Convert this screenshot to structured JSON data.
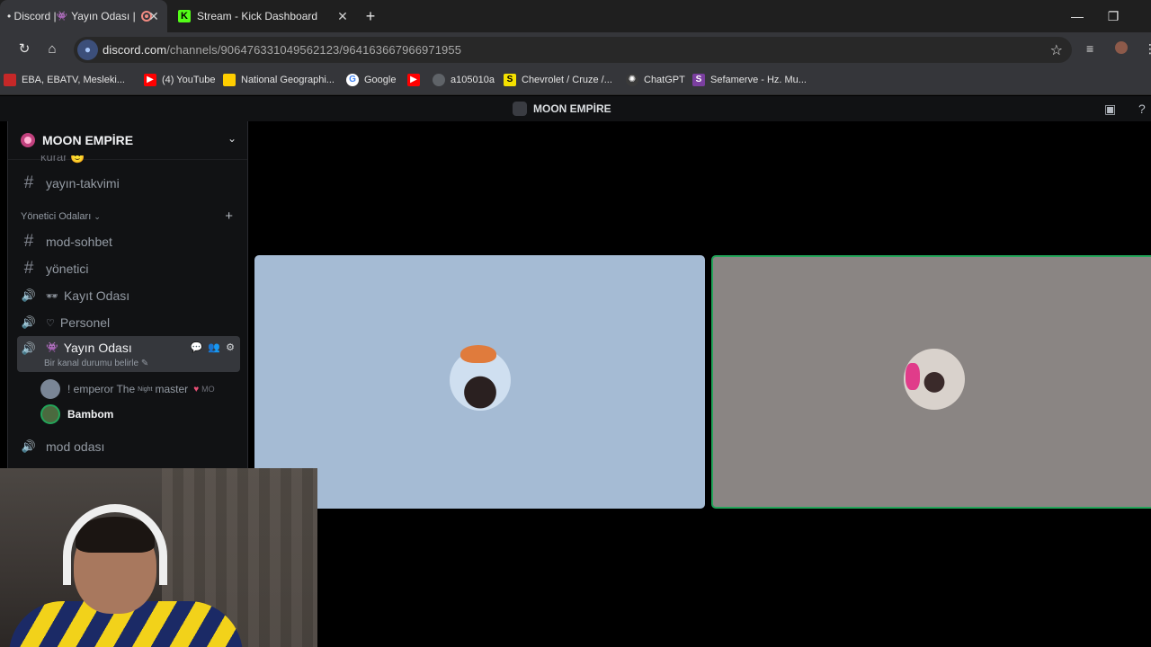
{
  "browser": {
    "tabs": [
      {
        "title": "• Discord | ",
        "sub_emoji": "👾",
        "sub_title": "Yayın Odası |",
        "active": true
      },
      {
        "title": "Stream - Kick Dashboard",
        "active": false
      }
    ],
    "url_main": "discord.com",
    "url_path": "/channels/906476331049562123/964163667966971955",
    "bookmarks": [
      {
        "label": "EBA, EBATV, Mesleki...",
        "color": "#e53935"
      },
      {
        "label": "(4) YouTube",
        "color": "#ff0000"
      },
      {
        "label": "National Geographi...",
        "color": "#ffce00"
      },
      {
        "label": "Google",
        "color": "#ffffff"
      },
      {
        "label": "",
        "color": "#ff0000"
      },
      {
        "label": "a105010a",
        "color": "#9aa0a6"
      },
      {
        "label": "Chevrolet / Cruze /...",
        "color": "#f5e100"
      },
      {
        "label": "ChatGPT",
        "color": "#9aa0a6"
      },
      {
        "label": "Sefamerve - Hz. Mu...",
        "color": "#7b3fa0"
      }
    ]
  },
  "discord": {
    "window_title": "MOON EMPİRE",
    "server_name": "MOON EMPİRE",
    "cut_channel": "kurar 🙂",
    "channels_top": [
      {
        "label": "yayın-takvimi"
      }
    ],
    "category": "Yönetici Odaları",
    "channels": [
      {
        "label": "mod-sohbet",
        "type": "text"
      },
      {
        "label": "yönetici",
        "type": "text"
      },
      {
        "label": "Kayıt Odası",
        "type": "voice",
        "emoji": "🕶"
      },
      {
        "label": "Personel",
        "type": "voice",
        "emoji": "♡"
      }
    ],
    "active_channel": {
      "label": "Yayın Odası",
      "emoji": "👾",
      "status": "Bir kanal durumu belirle"
    },
    "voice_users": [
      {
        "pre": "! emperor The",
        "sup": "Night",
        "post": "master",
        "tag": "MO"
      },
      {
        "name": "Bambom"
      }
    ],
    "after_channel": "mod odası"
  }
}
